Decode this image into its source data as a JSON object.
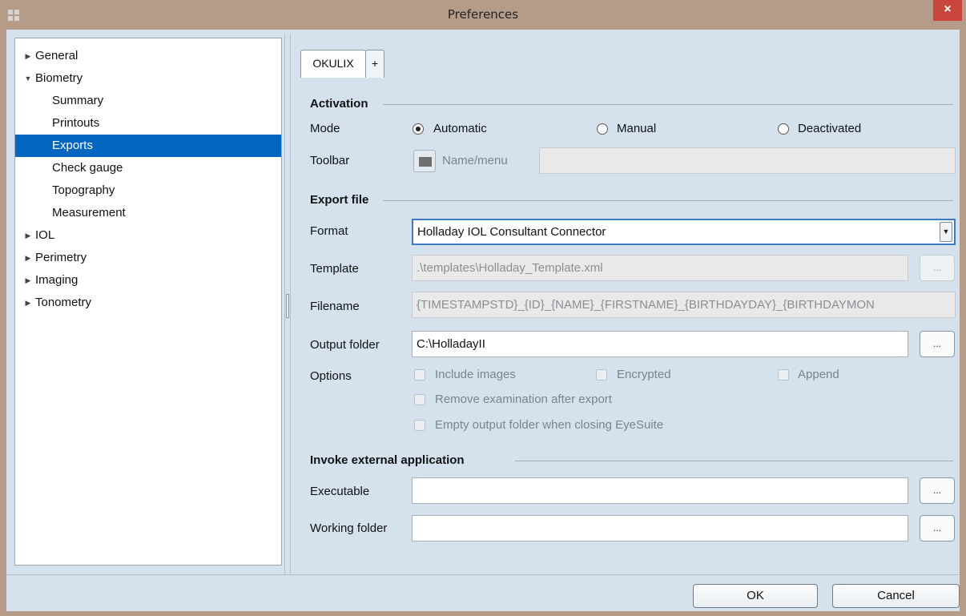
{
  "window": {
    "title": "Preferences",
    "close_glyph": "×"
  },
  "tree": {
    "items": [
      {
        "label": "General",
        "expanded": false,
        "level": 0
      },
      {
        "label": "Biometry",
        "expanded": true,
        "level": 0
      },
      {
        "label": "Summary",
        "level": 1
      },
      {
        "label": "Printouts",
        "level": 1
      },
      {
        "label": "Exports",
        "level": 1,
        "selected": true
      },
      {
        "label": "Check gauge",
        "level": 1
      },
      {
        "label": "Topography",
        "level": 1
      },
      {
        "label": "Measurement",
        "level": 1
      },
      {
        "label": "IOL",
        "expanded": false,
        "level": 0
      },
      {
        "label": "Perimetry",
        "expanded": false,
        "level": 0
      },
      {
        "label": "Imaging",
        "expanded": false,
        "level": 0
      },
      {
        "label": "Tonometry",
        "expanded": false,
        "level": 0
      }
    ],
    "arrow_collapsed": "▶",
    "arrow_expanded": "▼"
  },
  "tabs": {
    "active": "OKULIX",
    "add": "+"
  },
  "activation": {
    "title": "Activation",
    "mode_label": "Mode",
    "mode_options": [
      "Automatic",
      "Manual",
      "Deactivated"
    ],
    "mode_selected": "Automatic",
    "toolbar_label": "Toolbar",
    "name_menu_label": "Name/menu",
    "name_menu_value": ""
  },
  "export_file": {
    "title": "Export file",
    "format_label": "Format",
    "format_value": "Holladay IOL Consultant Connector",
    "template_label": "Template",
    "template_value": ".\\templates\\Holladay_Template.xml",
    "filename_label": "Filename",
    "filename_value": "{TIMESTAMPSTD}_{ID}_{NAME}_{FIRSTNAME}_{BIRTHDAYDAY}_{BIRTHDAYMON",
    "output_label": "Output folder",
    "output_value": "C:\\HolladayII",
    "options_label": "Options",
    "options": {
      "include_images": "Include images",
      "encrypted": "Encrypted",
      "append": "Append",
      "remove_exam": "Remove examination after export",
      "empty_folder": "Empty output folder when closing EyeSuite"
    },
    "browse_label": "..."
  },
  "invoke": {
    "title": "Invoke external application",
    "executable_label": "Executable",
    "executable_value": "",
    "working_label": "Working folder",
    "working_value": ""
  },
  "buttons": {
    "ok": "OK",
    "cancel": "Cancel"
  },
  "colors": {
    "titlebar": "#b49c88",
    "panel": "#d5e2ee",
    "selection": "#0566c2",
    "close": "#c8463d"
  }
}
